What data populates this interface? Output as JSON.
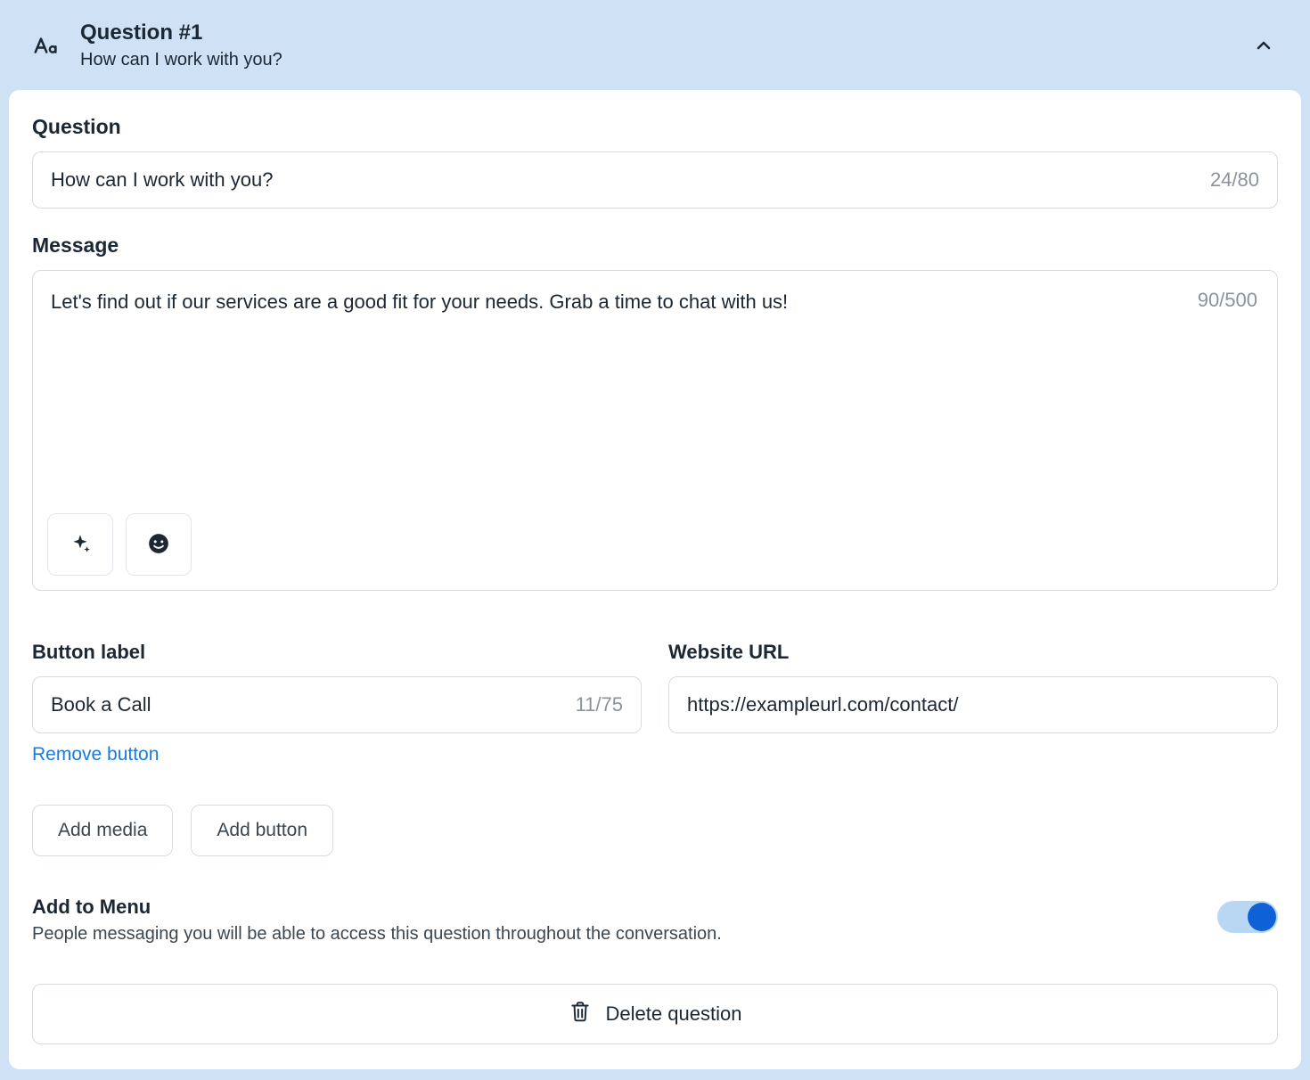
{
  "header": {
    "title": "Question #1",
    "subtitle": "How can I work with you?"
  },
  "question": {
    "label": "Question",
    "value": "How can I work with you?",
    "counter": "24/80"
  },
  "message": {
    "label": "Message",
    "value": "Let's find out if our services are a good fit for your needs. Grab a time to chat with us!",
    "counter": "90/500"
  },
  "button_label": {
    "label": "Button label",
    "value": "Book a Call",
    "counter": "11/75",
    "remove": "Remove button"
  },
  "website_url": {
    "label": "Website URL",
    "value": "https://exampleurl.com/contact/"
  },
  "actions": {
    "add_media": "Add media",
    "add_button": "Add button"
  },
  "add_to_menu": {
    "title": "Add to Menu",
    "description": "People messaging you will be able to access this question throughout the conversation."
  },
  "delete_label": "Delete question"
}
